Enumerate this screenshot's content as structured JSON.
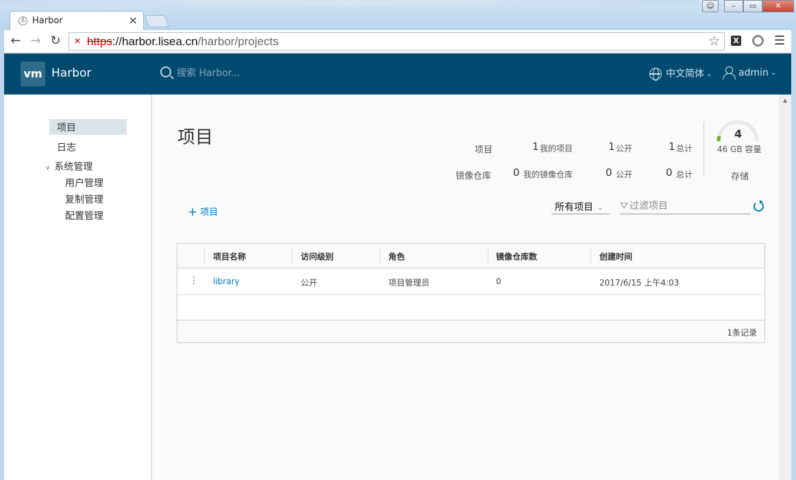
{
  "browser": {
    "tab_title": "Harbor",
    "url_scheme": "https",
    "url_host": "://harbor.lisea.cn",
    "url_path": "/harbor/projects"
  },
  "header": {
    "logo_text": "vm",
    "brand": "Harbor",
    "search_placeholder": "搜索 Harbor...",
    "language": "中文简体",
    "user": "admin"
  },
  "sidebar": {
    "items": [
      {
        "label": "项目",
        "active": true
      },
      {
        "label": "日志"
      },
      {
        "label": "系统管理"
      }
    ],
    "sub_items": [
      {
        "label": "用户管理"
      },
      {
        "label": "复制管理"
      },
      {
        "label": "配置管理"
      }
    ]
  },
  "main": {
    "title": "项目",
    "stats": {
      "projects_label": "项目",
      "my_projects_count": "1",
      "my_projects_label": "我的项目",
      "public_projects_count": "1",
      "public_label": "公开",
      "total_projects_count": "1",
      "total_label": "总计",
      "repos_label": "镜像仓库",
      "my_repos_count": "0",
      "my_repos_label": "我的镜像仓库",
      "public_repos_count": "0",
      "total_repos_count": "0"
    },
    "storage": {
      "value": "4",
      "capacity": "46 GB 容量",
      "label": "存储",
      "used_fraction": 0.08
    },
    "add_button": "项目",
    "filter_select": "所有项目",
    "filter_placeholder": "过滤项目",
    "table": {
      "columns": [
        "项目名称",
        "访问级别",
        "角色",
        "镜像仓库数",
        "创建时间"
      ],
      "rows": [
        {
          "name": "library",
          "access": "公开",
          "role": "项目管理员",
          "repos": "0",
          "created": "2017/6/15 上午4:03"
        }
      ],
      "footer": "1条记录"
    }
  },
  "colors": {
    "header_bg": "#004a70",
    "link": "#0079b8",
    "gauge": "#60b515"
  }
}
